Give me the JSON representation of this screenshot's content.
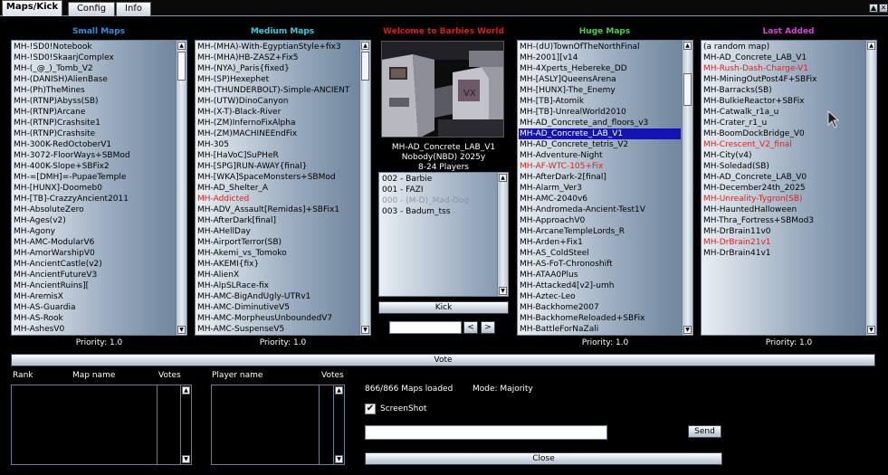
{
  "tabs": [
    {
      "label": "Maps/Kick",
      "active": true
    },
    {
      "label": "Config",
      "active": false
    },
    {
      "label": "Info",
      "active": false
    }
  ],
  "window_buttons": {
    "minimize": "▲",
    "close": "✕"
  },
  "columns": {
    "small": {
      "title": "Small Maps",
      "color": "#2b8fe8",
      "priority": "Priority: 1.0",
      "items": [
        "MH-!SD0!Notebook",
        "MH-!SD0!SkaarjComplex",
        "MH-(_@_)_Tomb_V2",
        "MH-(DANISH)AlienBase",
        "MH-(Ph)TheMines",
        "MH-(RTNP)Abyss(SB)",
        "MH-(RTNP)Arcane",
        "MH-(RTNP)Crashsite1",
        "MH-(RTNP)Crashsite",
        "MH-300K-RedOctoberV1",
        "MH-3072-FloorWays+SBMod",
        "MH-400K-Slope+SBFix2",
        "MH-=[DMH]=-PupaeTemple",
        "MH-[HUNX]-Doomeb0",
        "MH-[TB]-CrazzyAncient2011",
        "MH-AbsoluteZero",
        "MH-Ages(v2)",
        "MH-Agony",
        "MH-AMC-ModularV6",
        "MH-AmorWarshipV0",
        "MH-AncientCastle(v2)",
        "MH-AncientFutureV3",
        "MH-AncientRuins][",
        "MH-AremisX",
        "MH-AS-Guardia",
        "MH-AS-Rook",
        "MH-AshesV0"
      ],
      "red": []
    },
    "medium": {
      "title": "Medium Maps",
      "color": "#2fd0e6",
      "priority": "Priority: 1.0",
      "items": [
        "MH-(MHA)-With-EgyptianStyle+fix3",
        "MH-(MHA)HB-ZASZ+Fix5",
        "MH-(NYA)_Paris{fixed}",
        "MH-(SP)Hexephet",
        "MH-(THUNDERBOLT)-Simple-ANCIENT",
        "MH-(UTW)DinoCanyon",
        "MH-(X-T)-Black-River",
        "MH-(ZM)InfernoFixAlpha",
        "MH-(ZM)MACHINEEndFix",
        "MH-305",
        "MH-[HaVoC]SuPHeR",
        "MH-[SPG]RUN-AWAY{final}",
        "MH-[WKA]SpaceMonsters+SBMod",
        "MH-AD_Shelter_A",
        "MH-Addicted",
        "MH-ADV_Assault[Remidas]+SBFix1",
        "MH-AfterDark[final]",
        "MH-AHellDay",
        "MH-AirportTerror(SB)",
        "MH-Akemi_vs_Tomoko",
        "MH-AKEMI{fix}",
        "MH-AlienX",
        "MH-AlpSLRace-fix",
        "MH-AMC-BigAndUgly-UTRv1",
        "MH-AMC-DiminutiveV5",
        "MH-AMC-MorpheusUnboundedV7",
        "MH-AMC-SuspenseV5"
      ],
      "red": [
        14
      ]
    },
    "huge": {
      "title": "Huge Maps",
      "color": "#3ed63e",
      "priority": "Priority: 1.0",
      "items": [
        "MH-(dU)TownOfTheNorthFinal",
        "MH-2001][v14",
        "MH-4Xperts_Hebereke_DD",
        "MH-[ASLY]QueensArena",
        "MH-[HUNX]-The_Enemy",
        "MH-[TB]-Atomik",
        "MH-[TB]-UnrealWorld2010",
        "MH-AD_Concrete_and_floors_v3",
        "MH-AD_Concrete_LAB_V1",
        "MH-AD_Concrete_tetris_V2",
        "MH-Adventure-Night",
        "MH-AF-WTC-105+Fix",
        "MH-AfterDark-2[final]",
        "MH-Alarm_Ver3",
        "MH-AMC-2040v6",
        "MH-Andromeda-Ancient-Test1V",
        "MH-ApproachV0",
        "MH-ArcaneTempleLords_R",
        "MH-Arden+Fix1",
        "MH-AS_ColdSteel",
        "MH-AS-FoT-Chronoshift",
        "MH-ATAA0Plus",
        "MH-Attacked4[v2]-umh",
        "MH-Aztec-Leo",
        "MH-Backhome2007",
        "MH-BackhomeReloaded+SBFix",
        "MH-BattleForNaZali"
      ],
      "red": [
        11
      ],
      "selected": 8
    },
    "last": {
      "title": "Last Added",
      "color": "#e03ce0",
      "priority": "Priority: 1.0",
      "items": [
        "(a random map)",
        "MH-AD_Concrete_LAB_V1",
        "MH-Rush-Dash-Charge-V1",
        "MH-MiningOutPost4F+SBFix",
        "MH-Barracks(SB)",
        "MH-BulkieReactor+SBFix",
        "MH-Catwalk_r1a_u",
        "MH-Crater_r1_u",
        "MH-BoomDockBridge_V0",
        "MH-Crescent_V2_final",
        "MH-City(v4)",
        "MH-Soledad(SB)",
        "MH-AD_Concrete_LAB_V0",
        "MH-December24th_2025",
        "MH-Unreality-Tygron(SB)",
        "MH-HauntedHalloween",
        "MH-Thra_Fortress+SBMod3",
        "MH-DrBrain11v0",
        "MH-DrBrain21v1",
        "MH-DrBrain41v1"
      ],
      "red": [
        2,
        9,
        14,
        18
      ]
    }
  },
  "center": {
    "welcome": "Welcome to Barbies World",
    "map_name": "MH-AD_Concrete_LAB_V1",
    "author": "Nobody(NBD) 2025y",
    "players_range": "8-24 Players",
    "players": [
      {
        "text": "002 - Barbie",
        "dim": false
      },
      {
        "text": "001 - FAZI",
        "dim": false
      },
      {
        "text": "000 - (M-D)_Mad-Dog",
        "dim": true
      },
      {
        "text": "003 - Badum_tss",
        "dim": false
      }
    ],
    "kick_label": "Kick",
    "prev_label": "<",
    "next_label": ">"
  },
  "vote_label": "Vote",
  "bottom": {
    "rank_header": "Rank",
    "mapname_header": "Map name",
    "votes_header": "Votes",
    "player_header": "Player name",
    "player_votes_header": "Votes",
    "maps_loaded": "866/866 Maps loaded",
    "mode": "Mode: Majority",
    "screenshot_label": "ScreenShot",
    "screenshot_checked": true,
    "send_label": "Send",
    "close_label": "Close",
    "chat_value": ""
  }
}
